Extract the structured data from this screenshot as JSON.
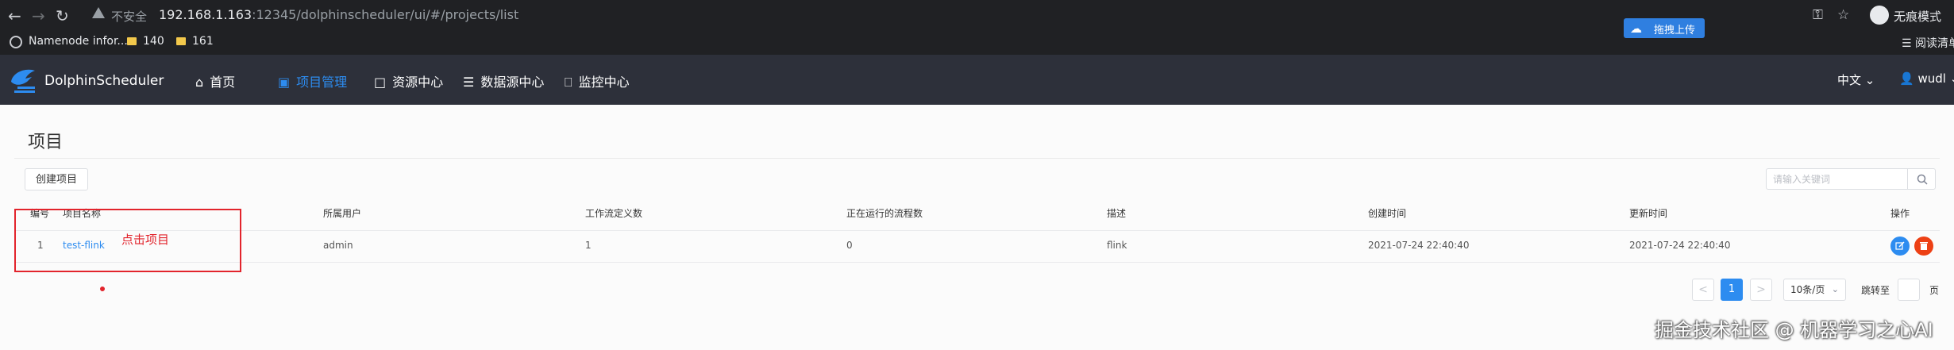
{
  "browser": {
    "security_label": "不安全",
    "url_host": "192.168.1.163",
    "url_rest": ":12345/dolphinscheduler/ui/#/projects/list",
    "incognito_label": "无痕模式",
    "extension_label": "拖拽上传",
    "bookmarks": [
      "Namenode infor...",
      "140",
      "161"
    ],
    "reading_list": "阅读清单"
  },
  "header": {
    "logo_text": "DolphinScheduler",
    "menu": [
      {
        "label": "首页",
        "icon": "home-icon"
      },
      {
        "label": "项目管理",
        "icon": "project-icon",
        "active": true
      },
      {
        "label": "资源中心",
        "icon": "folder-icon"
      },
      {
        "label": "数据源中心",
        "icon": "database-icon"
      },
      {
        "label": "监控中心",
        "icon": "monitor-icon"
      }
    ],
    "language": "中文",
    "username": "wudl"
  },
  "page": {
    "title": "项目",
    "create_button": "创建项目",
    "search_placeholder": "请输入关键词"
  },
  "table": {
    "columns": [
      "编号",
      "项目名称",
      "所属用户",
      "工作流定义数",
      "正在运行的流程数",
      "描述",
      "创建时间",
      "更新时间",
      "操作"
    ],
    "rows": [
      {
        "id": "1",
        "name": "test-flink",
        "owner": "admin",
        "definitions": "1",
        "running": "0",
        "description": "flink",
        "created": "2021-07-24 22:40:40",
        "updated": "2021-07-24 22:40:40"
      }
    ]
  },
  "annotation": {
    "text": "点击项目",
    "color": "#e2242c"
  },
  "pagination": {
    "prev": "<",
    "current": "1",
    "next": ">",
    "page_size": "10条/页",
    "jump_label": "跳转至",
    "page_unit": "页"
  },
  "watermark": "掘金技术社区 @ 机器学习之心AI",
  "colors": {
    "accent": "#2d8cf0",
    "header_bg": "#2d303a",
    "delete": "#ed4014",
    "edit": "#2d8cf0"
  }
}
